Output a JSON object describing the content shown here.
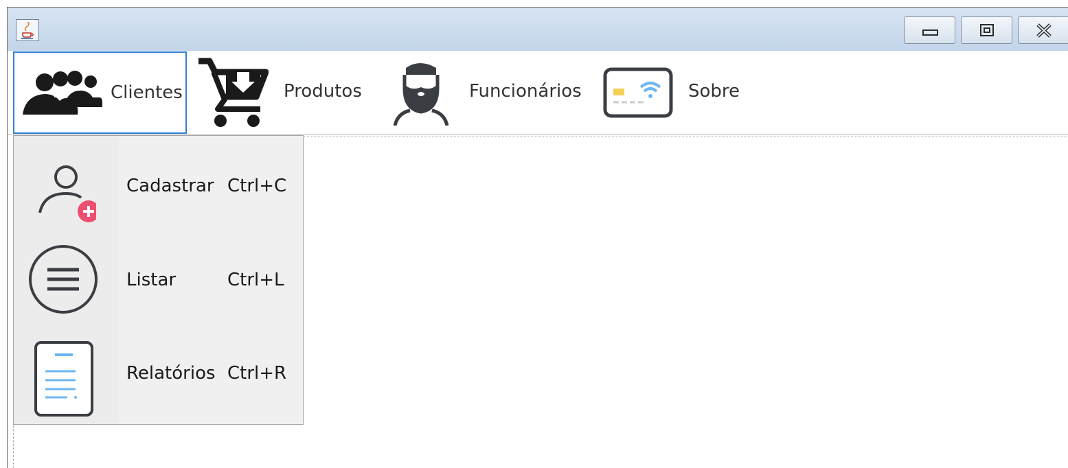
{
  "window": {
    "app_icon": "java-cup-icon",
    "controls": {
      "minimize": "minimize-icon",
      "maximize": "maximize-icon",
      "close": "close-icon"
    }
  },
  "menubar": {
    "items": [
      {
        "label": "Clientes",
        "icon": "people-icon",
        "selected": true
      },
      {
        "label": "Produtos",
        "icon": "shopping-cart-icon",
        "selected": false
      },
      {
        "label": "Funcionários",
        "icon": "bearded-man-icon",
        "selected": false
      },
      {
        "label": "Sobre",
        "icon": "wireless-card-icon",
        "selected": false
      }
    ]
  },
  "clientes_menu": {
    "items": [
      {
        "label": "Cadastrar",
        "shortcut": "Ctrl+C",
        "icon": "add-user-icon"
      },
      {
        "label": "Listar",
        "shortcut": "Ctrl+L",
        "icon": "list-circle-icon"
      },
      {
        "label": "Relatórios",
        "shortcut": "Ctrl+R",
        "icon": "report-document-icon"
      }
    ]
  },
  "colors": {
    "selection_border": "#2f7fd4",
    "add_badge": "#ef4f6e",
    "report_lines": "#6cb6f0",
    "card_chip": "#f5cf54"
  }
}
